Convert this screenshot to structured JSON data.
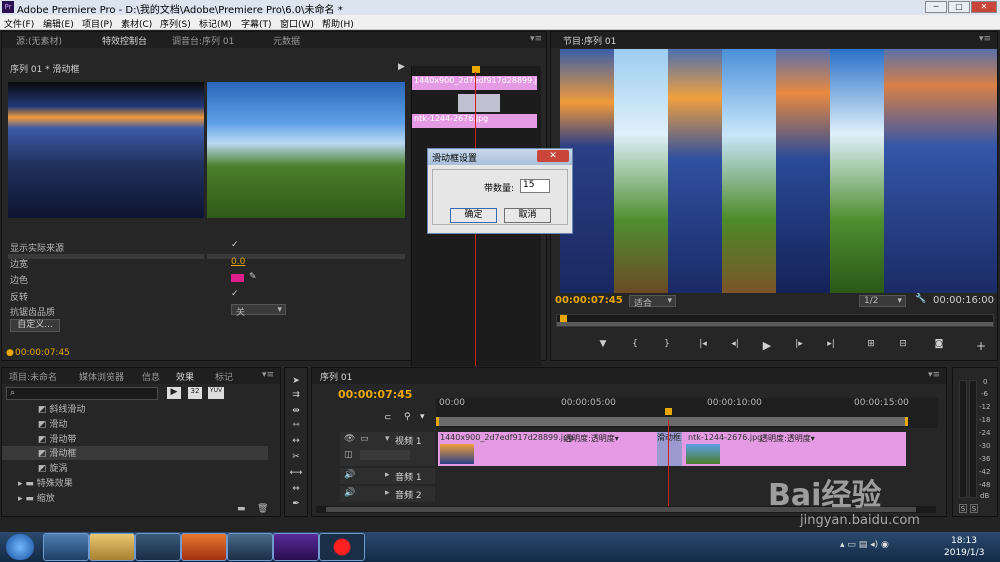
{
  "window": {
    "title": "Adobe Premiere Pro - D:\\我的文档\\Adobe\\Premiere Pro\\6.0\\未命名 *"
  },
  "menu": [
    "文件(F)",
    "编辑(E)",
    "项目(P)",
    "素材(C)",
    "序列(S)",
    "标记(M)",
    "字幕(T)",
    "窗口(W)",
    "帮助(H)"
  ],
  "source_panel": {
    "tabs": [
      "源:(无素材)",
      "特效控制台",
      "调音台:序列 01",
      "元数据"
    ],
    "header": "序列 01 * 滑动框",
    "props": {
      "show_source": "显示实际来源",
      "border_width": "边宽",
      "border_width_value": "0.0",
      "border_color": "边色",
      "reverse": "反转",
      "aa_quality": "抗锯齿品质",
      "aa_value": "关",
      "custom_btn": "自定义..."
    },
    "timecode": "00:00:07:45",
    "mini_clip_a": "1440x900_2d7edf917d28899.jpg",
    "mini_clip_b": "ntk-1244-2676.jpg"
  },
  "dialog": {
    "title": "滑动框设置",
    "label": "带数量:",
    "value": "15",
    "ok": "确定",
    "cancel": "取消"
  },
  "program_panel": {
    "tab": "节目:序列 01",
    "timecode": "00:00:07:45",
    "fit": "适合",
    "ratio": "1/2",
    "duration": "00:00:16:00"
  },
  "project_panel": {
    "tabs": [
      "项目:未命名",
      "媒体浏览器",
      "信息",
      "效果",
      "标记"
    ],
    "items": [
      "斜线滑动",
      "滑动",
      "滑动带",
      "滑动框",
      "旋涡"
    ],
    "folders": [
      "特殊效果",
      "缩放"
    ]
  },
  "timeline": {
    "tab": "序列 01",
    "timecode": "00:00:07:45",
    "ruler": [
      "00:00",
      "00:00:05:00",
      "00:00:10:00",
      "00:00:15:00"
    ],
    "tracks": {
      "video1": "视频 1",
      "audio1": "音频 1",
      "audio2": "音频 2"
    },
    "clip_a": "1440x900_2d7edf917d28899.jpg",
    "clip_a_fx": "透明度:透明度▾",
    "transition": "滑动框",
    "clip_b": "ntk-1244-2676.jpg",
    "clip_b_fx": "透明度:透明度▾"
  },
  "audio_meter": {
    "labels": [
      "0",
      "-6",
      "-12",
      "-18",
      "-24",
      "-30",
      "-36",
      "-42",
      "-48",
      "dB"
    ],
    "solo": "S"
  },
  "taskbar": {
    "time": "18:13",
    "date": "2019/1/3"
  },
  "watermark": {
    "brand": "Bai经验",
    "url": "jingyan.baidu.com"
  },
  "colors": {
    "accent": "#e8a800",
    "clip": "#e49be3",
    "playhead": "#d02020",
    "border_swatch": "#e0208a"
  }
}
